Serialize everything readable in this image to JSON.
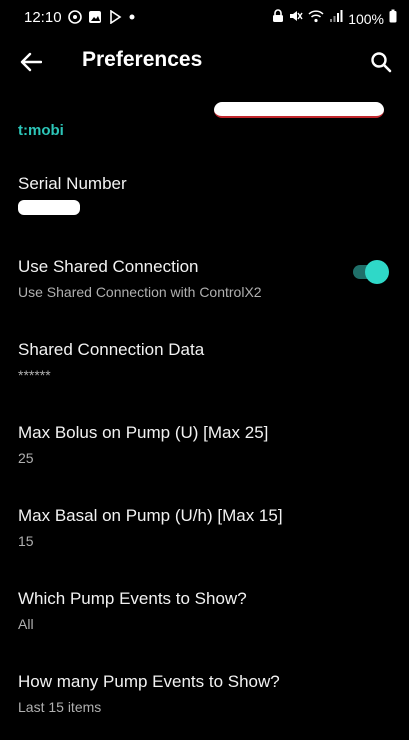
{
  "status_bar": {
    "time": "12:10",
    "battery": "100%",
    "left_icons": [
      "notification-icon",
      "gallery-icon",
      "play-icon",
      "dot-icon"
    ],
    "right_icons": [
      "lock-icon",
      "mute-icon",
      "wifi-icon",
      "signal-icon",
      "battery-icon"
    ]
  },
  "app_bar": {
    "title": "Preferences",
    "back_icon": "arrow-left-icon",
    "search_icon": "search-icon"
  },
  "category": {
    "label": "t:mobi",
    "accent_color": "#2cc5b8"
  },
  "preferences": [
    {
      "title": "Serial Number",
      "summary": ""
    },
    {
      "title": "Use Shared Connection",
      "summary": "Use Shared Connection with ControlX2",
      "toggle_on": true
    },
    {
      "title": "Shared Connection Data",
      "summary": "******"
    },
    {
      "title": "Max Bolus on Pump (U) [Max 25]",
      "summary": "25"
    },
    {
      "title": "Max Basal on Pump (U/h) [Max 15]",
      "summary": "15"
    },
    {
      "title": "Which Pump Events to Show?",
      "summary": "All"
    },
    {
      "title": "How many Pump Events to Show?",
      "summary": "Last 15 items"
    }
  ]
}
